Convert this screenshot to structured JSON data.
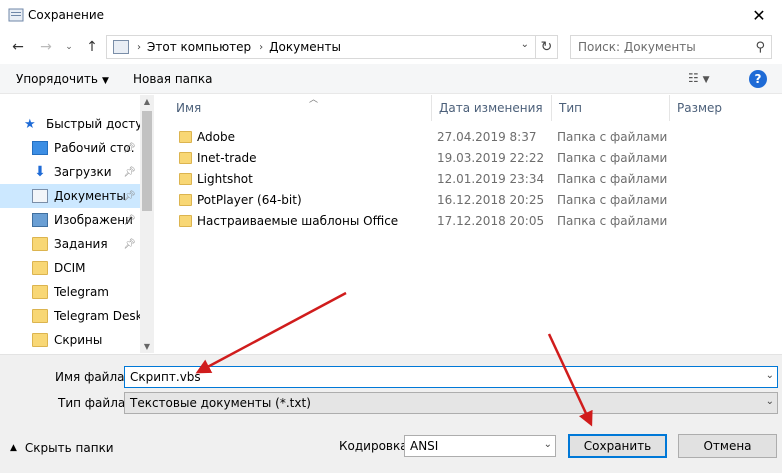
{
  "window": {
    "title": "Сохранение",
    "close_glyph": "✕"
  },
  "address": {
    "crumbs": [
      "Этот компьютер",
      "Документы"
    ],
    "separator": "›"
  },
  "search": {
    "placeholder": "Поиск: Документы"
  },
  "toolbar": {
    "organize": "Упорядочить",
    "new_folder": "Новая папка",
    "help": "?"
  },
  "nav": {
    "items": [
      {
        "label": "Быстрый доступ",
        "icon": "star-icon",
        "pinned": false
      },
      {
        "label": "Рабочий сто.",
        "icon": "desktop-icon",
        "pinned": true
      },
      {
        "label": "Загрузки",
        "icon": "download-icon",
        "pinned": true
      },
      {
        "label": "Документы",
        "icon": "documents-icon",
        "pinned": true,
        "selected": true
      },
      {
        "label": "Изображени",
        "icon": "pictures-icon",
        "pinned": true
      },
      {
        "label": "Задания",
        "icon": "folder-icon",
        "pinned": true
      },
      {
        "label": "DCIM",
        "icon": "folder-icon",
        "pinned": false
      },
      {
        "label": "Telegram",
        "icon": "folder-icon",
        "pinned": false
      },
      {
        "label": "Telegram Deskto",
        "icon": "folder-icon",
        "pinned": false
      },
      {
        "label": "Скрины",
        "icon": "folder-icon",
        "pinned": false
      }
    ]
  },
  "columns": {
    "name": "Имя",
    "date": "Дата изменения",
    "type": "Тип",
    "size": "Размер"
  },
  "files": [
    {
      "name": "Adobe",
      "date": "27.04.2019 8:37",
      "type": "Папка с файлами"
    },
    {
      "name": "Inet-trade",
      "date": "19.03.2019 22:22",
      "type": "Папка с файлами"
    },
    {
      "name": "Lightshot",
      "date": "12.01.2019 23:34",
      "type": "Папка с файлами"
    },
    {
      "name": "PotPlayer (64-bit)",
      "date": "16.12.2018 20:25",
      "type": "Папка с файлами"
    },
    {
      "name": "Настраиваемые шаблоны Office",
      "date": "17.12.2018 20:05",
      "type": "Папка с файлами"
    }
  ],
  "form": {
    "filename_label": "Имя файла:",
    "filename_value": "Скрипт.vbs",
    "filetype_label": "Тип файла:",
    "filetype_value": "Текстовые документы (*.txt)",
    "hide_folders": "Скрыть папки",
    "encoding_label": "Кодировка:",
    "encoding_value": "ANSI",
    "save": "Сохранить",
    "cancel": "Отмена"
  },
  "colors": {
    "accent": "#0078d7",
    "selection": "#cce8ff",
    "arrow": "#d01c1c",
    "folder": "#f8d775"
  }
}
